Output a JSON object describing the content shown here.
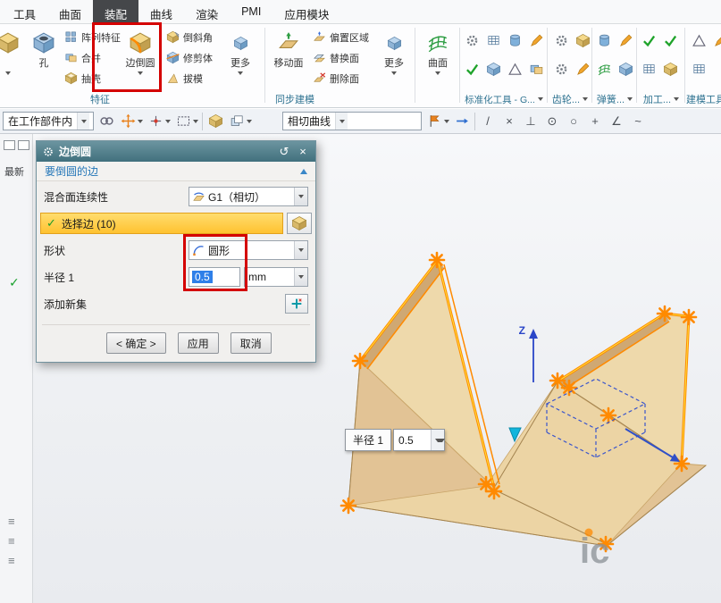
{
  "menubar": {
    "items": [
      "工具",
      "曲面",
      "装配",
      "曲线",
      "渲染",
      "PMI",
      "应用模块"
    ]
  },
  "ribbon": {
    "feature": {
      "hole": "孔",
      "pattern": "阵列特征",
      "unite": "合并",
      "shell": "抽壳",
      "edge_blend": "边倒圆",
      "chamfer": "倒斜角",
      "trim": "修剪体",
      "draft": "拔模",
      "more": "更多"
    },
    "sync": {
      "move_face": "移动面",
      "offset": "偏置区域",
      "replace": "替换面",
      "delete": "删除面",
      "more": "更多"
    },
    "surface_label": "曲面",
    "labels": {
      "feature": "特征",
      "sync": "同步建模",
      "standard": "标准化工具 - G...",
      "gear": "齿轮...",
      "spring": "弹簧...",
      "machining": "加工...",
      "modeling": "建模工具"
    }
  },
  "selection_bar": {
    "scope": "在工作部件内",
    "curve_rule": "相切曲线"
  },
  "navigator": {
    "latest": "最新"
  },
  "dialog": {
    "title": "边倒圆",
    "section": "要倒圆的边",
    "continuity_label": "混合面连续性",
    "continuity_value": "G1（相切）",
    "select_edges": "选择边 (10)",
    "shape_label": "形状",
    "shape_value": "圆形",
    "radius_label": "半径 1",
    "radius_value": "0.5",
    "radius_unit": "mm",
    "add_new_set": "添加新集",
    "ok": "< 确定 >",
    "apply": "应用",
    "cancel": "取消"
  },
  "viewport": {
    "radius_label": "半径 1",
    "radius_value": "0.5",
    "z_label": "Z",
    "watermark": "ic"
  },
  "icons": {
    "slash": "/",
    "cross": "×",
    "perp": "⊥",
    "circ_dot": "⊙",
    "circ": "○",
    "plus": "+",
    "angle": "∠",
    "tilde": "~",
    "list": "≡",
    "check": "✓",
    "reset": "↺",
    "close": "×"
  }
}
